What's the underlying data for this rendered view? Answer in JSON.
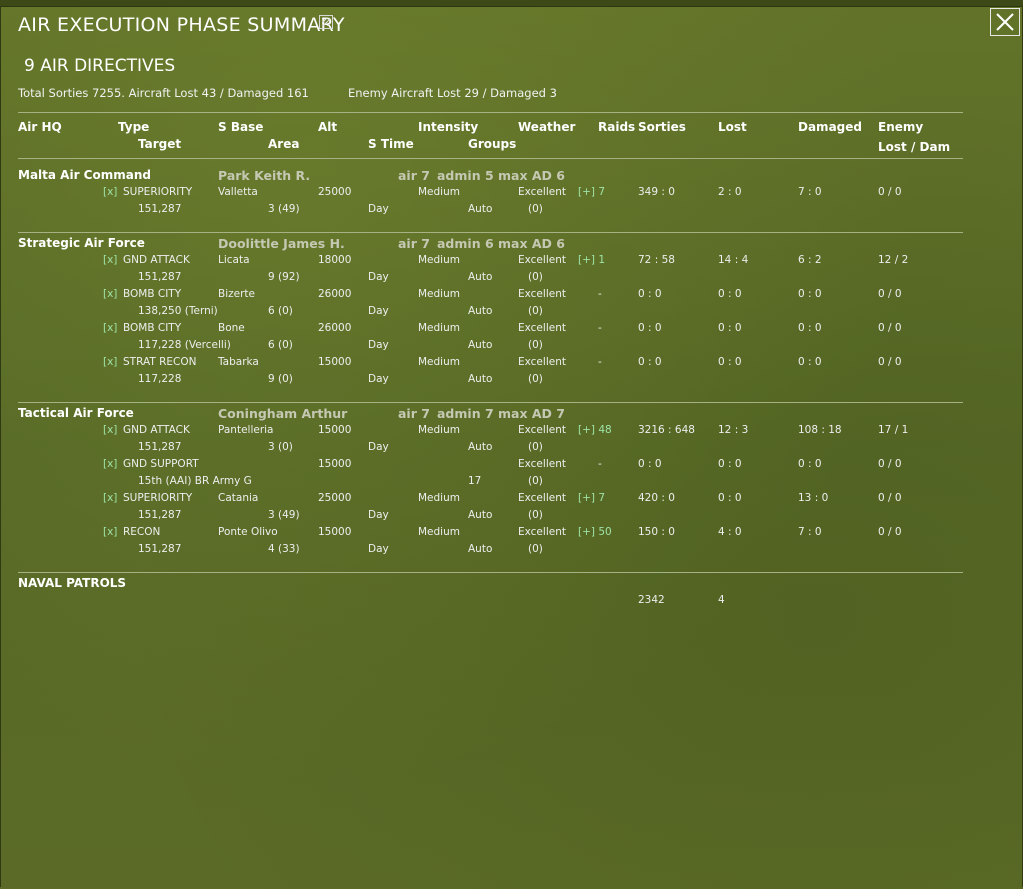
{
  "window": {
    "title": "AIR EXECUTION PHASE SUMMARY",
    "heading": "9 AIR DIRECTIVES",
    "close_icon": "close-x-icon",
    "title_icon": "report-icon"
  },
  "totals": {
    "own": "Total Sorties 7255. Aircraft Lost 43 / Damaged 161",
    "enemy": "Enemy Aircraft Lost 29 / Damaged 3"
  },
  "headers": {
    "air_hq": "Air HQ",
    "type": "Type",
    "target": "Target",
    "s_base": "S Base",
    "area": "Area",
    "alt": "Alt",
    "s_time": "S Time",
    "intensity": "Intensity",
    "groups": "Groups",
    "weather": "Weather",
    "raids": "Raids",
    "sorties": "Sorties",
    "lost": "Lost",
    "damaged": "Damaged",
    "enemy": "Enemy",
    "enemy_lost_dam": "Lost / Dam"
  },
  "hqs": [
    {
      "name": "Malta Air Command",
      "commander": "Park Keith R.",
      "air": "air 7",
      "admin": "admin 5",
      "max_ad": "max AD 6",
      "missions": [
        {
          "check": "[x]",
          "type": "SUPERIORITY",
          "target": "151,287",
          "base": "Valletta",
          "area": "3 (49)",
          "alt": "25000",
          "time": "Day",
          "intensity": "Medium",
          "groups": "Auto",
          "weather": "Excellent",
          "raid_count": "(0)",
          "raids": "[+] 7",
          "sorties": "349 : 0",
          "lost": "2 : 0",
          "damaged": "7 : 0",
          "enemy": "0 / 0"
        }
      ]
    },
    {
      "name": "Strategic Air Force",
      "commander": "Doolittle James H.",
      "air": "air 7",
      "admin": "admin 6",
      "max_ad": "max AD 6",
      "missions": [
        {
          "check": "[x]",
          "type": "GND ATTACK",
          "target": "151,287",
          "base": "Licata",
          "area": "9 (92)",
          "alt": "18000",
          "time": "Day",
          "intensity": "Medium",
          "groups": "Auto",
          "weather": "Excellent",
          "raid_count": "(0)",
          "raids": "[+] 1",
          "sorties": "72 : 58",
          "lost": "14 : 4",
          "damaged": "6 : 2",
          "enemy": "12 / 2"
        },
        {
          "check": "[x]",
          "type": "BOMB CITY",
          "target": "138,250 (Terni)",
          "base": "Bizerte",
          "area": "6 (0)",
          "alt": "26000",
          "time": "Day",
          "intensity": "Medium",
          "groups": "Auto",
          "weather": "Excellent",
          "raid_count": "(0)",
          "raids": "-",
          "sorties": "0 : 0",
          "lost": "0 : 0",
          "damaged": "0 : 0",
          "enemy": "0 / 0"
        },
        {
          "check": "[x]",
          "type": "BOMB CITY",
          "target": "117,228 (Vercelli)",
          "base": "Bone",
          "area": "6 (0)",
          "alt": "26000",
          "time": "Day",
          "intensity": "Medium",
          "groups": "Auto",
          "weather": "Excellent",
          "raid_count": "(0)",
          "raids": "-",
          "sorties": "0 : 0",
          "lost": "0 : 0",
          "damaged": "0 : 0",
          "enemy": "0 / 0"
        },
        {
          "check": "[x]",
          "type": "STRAT RECON",
          "target": "117,228",
          "base": "Tabarka",
          "area": "9 (0)",
          "alt": "15000",
          "time": "Day",
          "intensity": "Medium",
          "groups": "Auto",
          "weather": "Excellent",
          "raid_count": "(0)",
          "raids": "-",
          "sorties": "0 : 0",
          "lost": "0 : 0",
          "damaged": "0 : 0",
          "enemy": "0 / 0"
        }
      ]
    },
    {
      "name": "Tactical Air Force",
      "commander": "Coningham Arthur",
      "air": "air 7",
      "admin": "admin 7",
      "max_ad": "max AD 7",
      "missions": [
        {
          "check": "[x]",
          "type": "GND ATTACK",
          "target": "151,287",
          "base": "Pantelleria",
          "area": "3 (0)",
          "alt": "15000",
          "time": "Day",
          "intensity": "Medium",
          "groups": "Auto",
          "weather": "Excellent",
          "raid_count": "(0)",
          "raids": "[+] 48",
          "sorties": "3216 : 648",
          "lost": "12 : 3",
          "damaged": "108 : 18",
          "enemy": "17 / 1"
        },
        {
          "check": "[x]",
          "type": "GND SUPPORT",
          "target": "15th (AAI) BR Army G",
          "base": "",
          "area": "",
          "alt": "15000",
          "time": "",
          "intensity": "",
          "groups": "17",
          "weather": "Excellent",
          "raid_count": "(0)",
          "raids": "-",
          "sorties": "0 : 0",
          "lost": "0 : 0",
          "damaged": "0 : 0",
          "enemy": "0 / 0"
        },
        {
          "check": "[x]",
          "type": "SUPERIORITY",
          "target": "151,287",
          "base": "Catania",
          "area": "3 (49)",
          "alt": "25000",
          "time": "Day",
          "intensity": "Medium",
          "groups": "Auto",
          "weather": "Excellent",
          "raid_count": "(0)",
          "raids": "[+] 7",
          "sorties": "420 : 0",
          "lost": "0 : 0",
          "damaged": "13 : 0",
          "enemy": "0 / 0"
        },
        {
          "check": "[x]",
          "type": "RECON",
          "target": "151,287",
          "base": "Ponte Olivo",
          "area": "4 (33)",
          "alt": "15000",
          "time": "Day",
          "intensity": "Medium",
          "groups": "Auto",
          "weather": "Excellent",
          "raid_count": "(0)",
          "raids": "[+] 50",
          "sorties": "150 : 0",
          "lost": "4 : 0",
          "damaged": "7 : 0",
          "enemy": "0 / 0"
        }
      ]
    }
  ],
  "naval": {
    "label": "NAVAL PATROLS",
    "sorties": "2342",
    "lost": "4"
  }
}
